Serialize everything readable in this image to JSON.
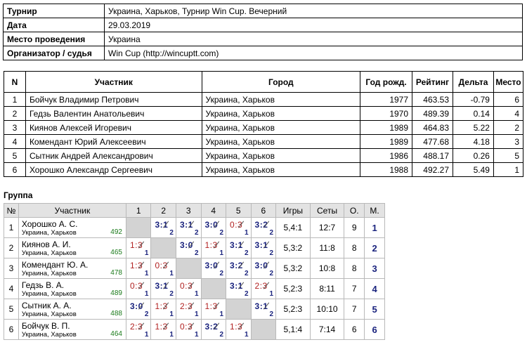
{
  "info": [
    {
      "label": "Турнир",
      "value": "Украина, Харьков, Турнир Win Cup. Вечерний"
    },
    {
      "label": "Дата",
      "value": "29.03.2019"
    },
    {
      "label": "Место проведения",
      "value": "Украина"
    },
    {
      "label": "Организатор / судья",
      "value": "Win Cup (http://wincuptt.com)"
    }
  ],
  "participants": {
    "headers": [
      "N",
      "Участник",
      "Город",
      "Год рожд.",
      "Рейтинг",
      "Дельта",
      "Место"
    ],
    "rows": [
      {
        "n": "1",
        "name": "Бойчук Владимир Петрович",
        "city": "Украина, Харьков",
        "year": "1977",
        "rating": "463.53",
        "delta": "-0.79",
        "place": "6"
      },
      {
        "n": "2",
        "name": "Гедзь Валентин Анатольевич",
        "city": "Украина, Харьков",
        "year": "1970",
        "rating": "489.39",
        "delta": "0.14",
        "place": "4"
      },
      {
        "n": "3",
        "name": "Киянов Алексей Игоревич",
        "city": "Украина, Харьков",
        "year": "1989",
        "rating": "464.83",
        "delta": "5.22",
        "place": "2"
      },
      {
        "n": "4",
        "name": "Комендант Юрий Алексеевич",
        "city": "Украина, Харьков",
        "year": "1989",
        "rating": "477.68",
        "delta": "4.18",
        "place": "3"
      },
      {
        "n": "5",
        "name": "Сытник Андрей Александрович",
        "city": "Украина, Харьков",
        "year": "1986",
        "rating": "488.17",
        "delta": "0.26",
        "place": "5"
      },
      {
        "n": "6",
        "name": "Хорошко Александр Сергеевич",
        "city": "Украина, Харьков",
        "year": "1988",
        "rating": "492.27",
        "delta": "5.49",
        "place": "1"
      }
    ]
  },
  "group": {
    "title": "Группа",
    "headers": [
      "№",
      "Участник",
      "1",
      "2",
      "3",
      "4",
      "5",
      "6",
      "Игры",
      "Сеты",
      "О.",
      "М."
    ],
    "rows": [
      {
        "n": "1",
        "name": "Хорошко А. С.",
        "city": "Украина, Харьков",
        "rating": "492",
        "results": [
          null,
          {
            "score": "3:1",
            "pts": "2",
            "win": true
          },
          {
            "score": "3:1",
            "pts": "2",
            "win": true
          },
          {
            "score": "3:0",
            "pts": "2",
            "win": true
          },
          {
            "score": "0:3",
            "pts": "1",
            "win": false
          },
          {
            "score": "3:2",
            "pts": "2",
            "win": true
          }
        ],
        "games": "5,4:1",
        "sets": "12:7",
        "points": "9",
        "place": "1"
      },
      {
        "n": "2",
        "name": "Киянов А. И.",
        "city": "Украина, Харьков",
        "rating": "465",
        "results": [
          {
            "score": "1:3",
            "pts": "1",
            "win": false
          },
          null,
          {
            "score": "3:0",
            "pts": "2",
            "win": true
          },
          {
            "score": "1:3",
            "pts": "1",
            "win": false
          },
          {
            "score": "3:1",
            "pts": "2",
            "win": true
          },
          {
            "score": "3:1",
            "pts": "2",
            "win": true
          }
        ],
        "games": "5,3:2",
        "sets": "11:8",
        "points": "8",
        "place": "2"
      },
      {
        "n": "3",
        "name": "Комендант Ю. А.",
        "city": "Украина, Харьков",
        "rating": "478",
        "results": [
          {
            "score": "1:3",
            "pts": "1",
            "win": false
          },
          {
            "score": "0:3",
            "pts": "1",
            "win": false
          },
          null,
          {
            "score": "3:0",
            "pts": "2",
            "win": true
          },
          {
            "score": "3:2",
            "pts": "2",
            "win": true
          },
          {
            "score": "3:0",
            "pts": "2",
            "win": true
          }
        ],
        "games": "5,3:2",
        "sets": "10:8",
        "points": "8",
        "place": "3"
      },
      {
        "n": "4",
        "name": "Гедзь В. А.",
        "city": "Украина, Харьков",
        "rating": "489",
        "results": [
          {
            "score": "0:3",
            "pts": "1",
            "win": false
          },
          {
            "score": "3:1",
            "pts": "2",
            "win": true
          },
          {
            "score": "0:3",
            "pts": "1",
            "win": false
          },
          null,
          {
            "score": "3:1",
            "pts": "2",
            "win": true
          },
          {
            "score": "2:3",
            "pts": "1",
            "win": false
          }
        ],
        "games": "5,2:3",
        "sets": "8:11",
        "points": "7",
        "place": "4"
      },
      {
        "n": "5",
        "name": "Сытник А. А.",
        "city": "Украина, Харьков",
        "rating": "488",
        "results": [
          {
            "score": "3:0",
            "pts": "2",
            "win": true
          },
          {
            "score": "1:3",
            "pts": "1",
            "win": false
          },
          {
            "score": "2:3",
            "pts": "1",
            "win": false
          },
          {
            "score": "1:3",
            "pts": "1",
            "win": false
          },
          null,
          {
            "score": "3:1",
            "pts": "2",
            "win": true
          }
        ],
        "games": "5,2:3",
        "sets": "10:10",
        "points": "7",
        "place": "5"
      },
      {
        "n": "6",
        "name": "Бойчук В. П.",
        "city": "Украина, Харьков",
        "rating": "464",
        "results": [
          {
            "score": "2:3",
            "pts": "1",
            "win": false
          },
          {
            "score": "1:3",
            "pts": "1",
            "win": false
          },
          {
            "score": "0:3",
            "pts": "1",
            "win": false
          },
          {
            "score": "3:2",
            "pts": "2",
            "win": true
          },
          {
            "score": "1:3",
            "pts": "1",
            "win": false
          },
          null
        ],
        "games": "5,1:4",
        "sets": "7:14",
        "points": "6",
        "place": "6"
      }
    ]
  }
}
